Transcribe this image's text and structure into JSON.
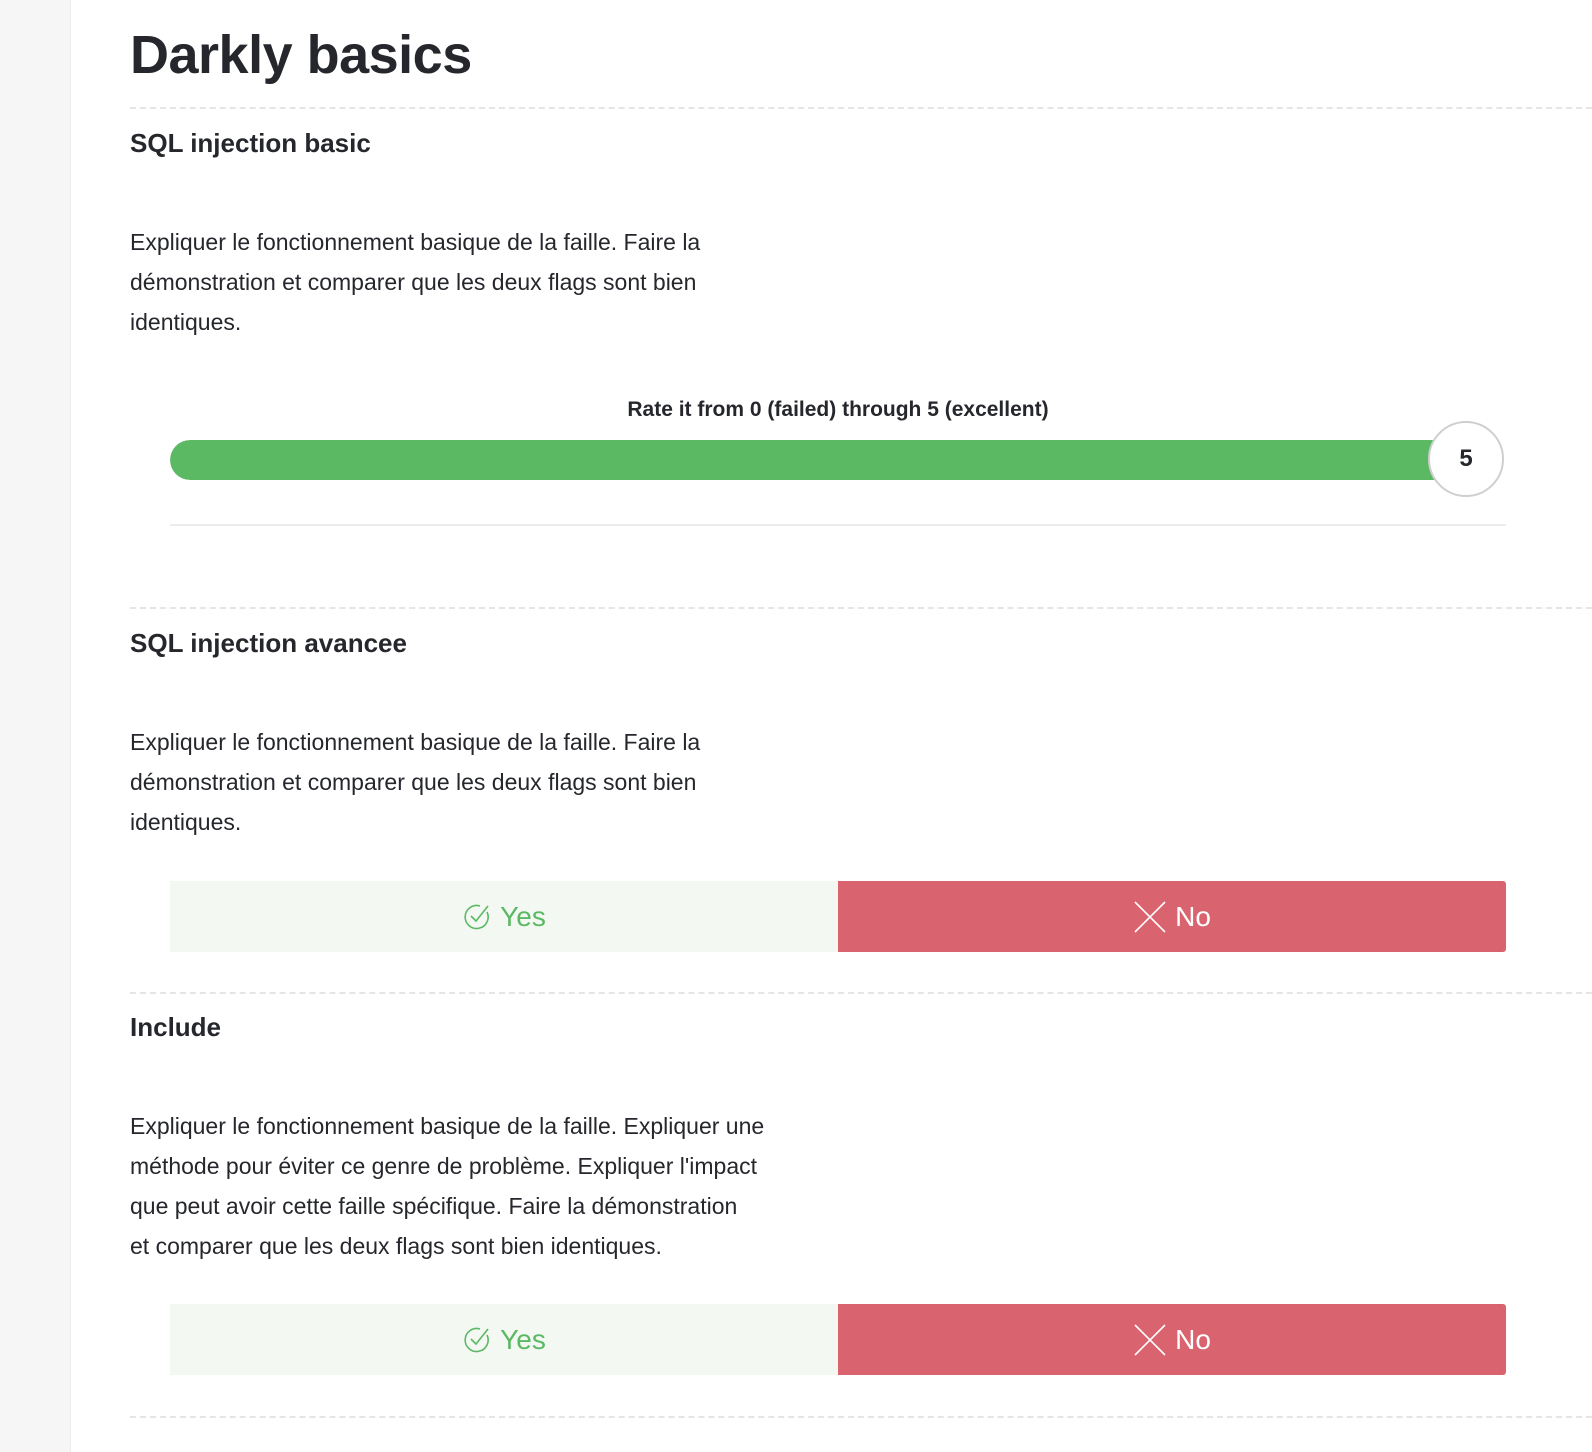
{
  "page": {
    "title": "Darkly basics"
  },
  "sections": [
    {
      "title": "SQL injection basic",
      "description_lines": [
        "Expliquer le fonctionnement basique de la faille. Faire la",
        "démonstration et comparer que les deux flags sont bien",
        "identiques."
      ],
      "rating": {
        "label": "Rate it from 0 (failed) through 5 (excellent)",
        "min": 0,
        "max": 5,
        "value": 5,
        "value_text": "5"
      }
    },
    {
      "title": "SQL injection avancee",
      "description_lines": [
        "Expliquer le fonctionnement basique de la faille. Faire la",
        "démonstration et comparer que les deux flags sont bien",
        "identiques."
      ],
      "yes_label": "Yes",
      "no_label": "No",
      "yes_icon": "check-circle-icon",
      "no_icon": "close-icon"
    },
    {
      "title": "Include",
      "description_lines": [
        "Expliquer le fonctionnement basique de la faille. Expliquer une",
        "méthode pour éviter ce genre de problème. Expliquer l'impact",
        "que peut avoir cette faille spécifique. Faire la démonstration",
        "et comparer que les deux flags sont bien identiques."
      ],
      "yes_label": "Yes",
      "no_label": "No",
      "yes_icon": "check-circle-icon",
      "no_icon": "close-icon"
    }
  ],
  "colors": {
    "accent_green": "#5cb963",
    "no_red": "#d9646f",
    "yes_bg": "#f3f8f3",
    "text": "#25272c"
  }
}
